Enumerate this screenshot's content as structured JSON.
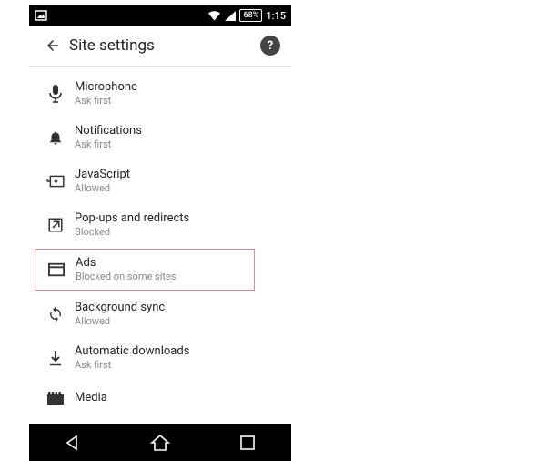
{
  "status": {
    "battery": "68%",
    "time": "1:15"
  },
  "app_bar": {
    "title": "Site settings"
  },
  "rows": {
    "microphone": {
      "title": "Microphone",
      "sub": "Ask first"
    },
    "notifications": {
      "title": "Notifications",
      "sub": "Ask first"
    },
    "javascript": {
      "title": "JavaScript",
      "sub": "Allowed"
    },
    "popups": {
      "title": "Pop-ups and redirects",
      "sub": "Blocked"
    },
    "ads": {
      "title": "Ads",
      "sub": "Blocked on some sites"
    },
    "bg_sync": {
      "title": "Background sync",
      "sub": "Allowed"
    },
    "auto_dl": {
      "title": "Automatic downloads",
      "sub": "Ask first"
    },
    "media": {
      "title": "Media",
      "sub": ""
    }
  }
}
